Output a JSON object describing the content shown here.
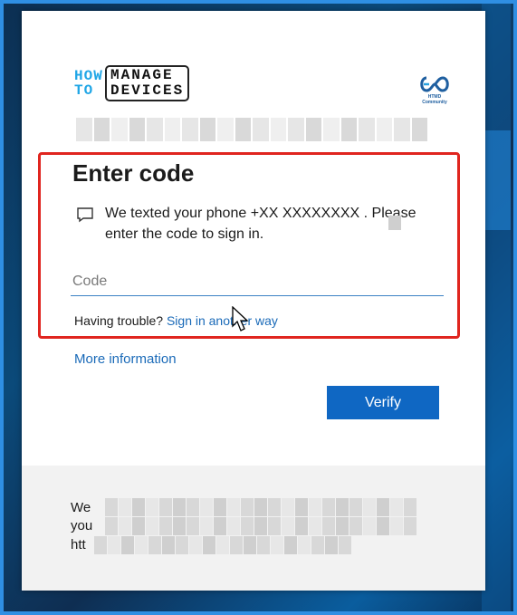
{
  "colors": {
    "accent": "#0f67c3",
    "highlight": "#e0251f",
    "link": "#1a6ab8"
  },
  "branding": {
    "how": "HOW",
    "to": "TO",
    "manage": "MANAGE",
    "devices": "DEVICES",
    "right_logo_caption": "HTMD Community"
  },
  "dialog": {
    "title": "Enter code",
    "message": "We texted your phone +XX XXXXXXXX  . Please enter the code to sign in.",
    "code_placeholder": "Code",
    "trouble_text": "Having trouble?",
    "trouble_link": "Sign in another way",
    "more_info": "More information",
    "verify_label": "Verify"
  },
  "footer": {
    "line1": "We",
    "line2": "you",
    "line3": "htt"
  }
}
